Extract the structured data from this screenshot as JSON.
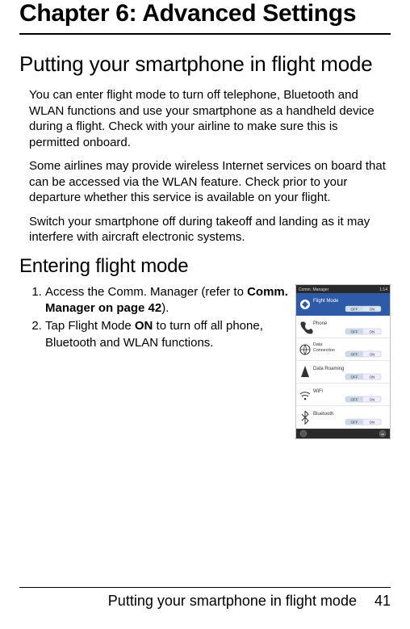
{
  "chapter": {
    "title": "Chapter 6: Advanced Settings"
  },
  "section1": {
    "title": "Putting your smartphone in flight mode",
    "p1": "You can enter flight mode to turn off telephone, Bluetooth and WLAN functions and use your smartphone as a handheld device during a flight. Check with your airline to make sure this is permitted onboard.",
    "p2": "Some airlines may provide wireless Internet services on board that can be accessed via the WLAN feature. Check prior to your departure whether this service is available on your flight.",
    "p3": "Switch your smartphone off during takeoff and landing as it may interfere with aircraft electronic systems."
  },
  "section2": {
    "title": "Entering flight mode",
    "steps": {
      "s1a": "Access the Comm. Manager (refer to ",
      "s1b": "Comm. Manager on page 42",
      "s1c": ").",
      "s2a": "Tap Flight Mode ",
      "s2b": "ON",
      "s2c": " to turn off all phone, Bluetooth and WLAN functions."
    }
  },
  "screenshot": {
    "title": "Comm. Manager",
    "time": "1:14",
    "off": "OFF",
    "on": "ON",
    "rows": {
      "r1": "Flight Mode",
      "r2": "Phone",
      "r3": "Data Connection",
      "r4": "Data Roaming",
      "r5": "WiFi",
      "r6": "Bluetooth"
    }
  },
  "footer": {
    "title": "Putting your smartphone in flight mode",
    "page": "41"
  }
}
